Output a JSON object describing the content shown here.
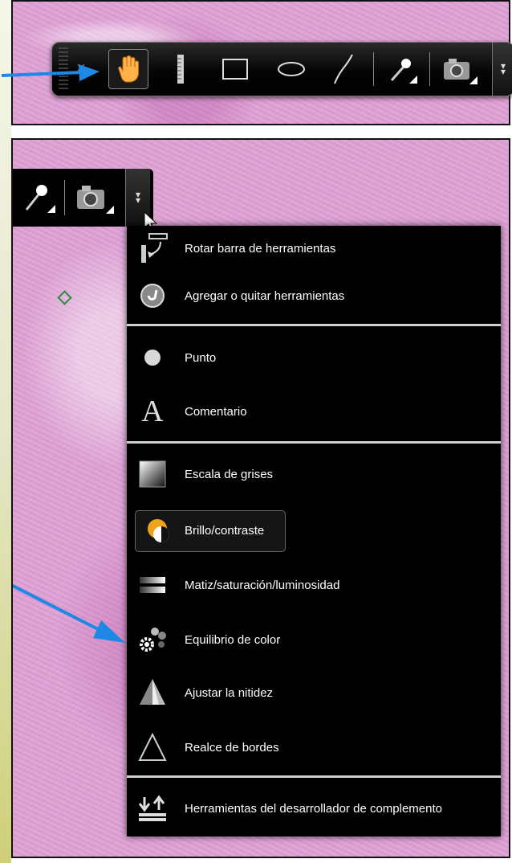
{
  "top_toolbar": {
    "tools": [
      {
        "icon": "close-icon"
      },
      {
        "icon": "hand-pan-icon",
        "active": true
      },
      {
        "icon": "ruler-icon"
      },
      {
        "icon": "rectangle-icon"
      },
      {
        "icon": "ellipse-icon"
      },
      {
        "icon": "freehand-icon"
      },
      {
        "icon": "magic-wand-icon"
      },
      {
        "icon": "camera-icon"
      },
      {
        "icon": "chevron-double-down-icon"
      }
    ]
  },
  "mini_toolbar": {
    "tools": [
      {
        "icon": "magic-wand-icon"
      },
      {
        "icon": "camera-icon"
      },
      {
        "icon": "chevron-double-down-icon"
      }
    ]
  },
  "menu": {
    "groups": [
      [
        {
          "label": "Rotar barra de herramientas",
          "icon": "rotate-toolbar-icon"
        },
        {
          "label": "Agregar o quitar herramientas",
          "icon": "add-remove-tools-icon"
        }
      ],
      [
        {
          "label": "Punto",
          "icon": "point-icon"
        },
        {
          "label": "Comentario",
          "icon": "comment-a-icon"
        }
      ],
      [
        {
          "label": "Escala de grises",
          "icon": "grayscale-icon"
        },
        {
          "label": "Brillo/contraste",
          "icon": "brightness-contrast-icon",
          "highlighted": true
        },
        {
          "label": "Matiz/saturación/luminosidad",
          "icon": "hue-saturation-icon"
        },
        {
          "label": "Equilibrio de color",
          "icon": "color-balance-icon"
        },
        {
          "label": "Ajustar la nitidez",
          "icon": "sharpen-icon"
        },
        {
          "label": "Realce de bordes",
          "icon": "edge-enhance-icon"
        }
      ],
      [
        {
          "label": "Herramientas del desarrollador de complemento",
          "icon": "developer-tools-icon"
        }
      ]
    ]
  },
  "colors": {
    "tissue": "#dfa6d6",
    "arrow": "#1e88e5",
    "menu_bg": "#000000",
    "marker": "#2e8b3e"
  }
}
